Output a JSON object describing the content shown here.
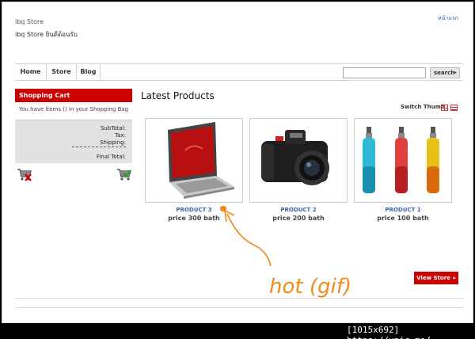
{
  "header": {
    "store_name": "ibq Store",
    "tagline": "ibq Store ยินดีต้อนรับ",
    "home_link": "หน้าแรก"
  },
  "nav": {
    "items": [
      {
        "label": "Home"
      },
      {
        "label": "Store"
      },
      {
        "label": "Blog"
      }
    ],
    "search_value": "",
    "search_button": "search",
    "search_arrow": "▸"
  },
  "cart": {
    "title": "Shopping Cart",
    "info": "You have items () in your Shopping Bag",
    "subtotal_label": "SubTotal:",
    "tax_label": "Tax:",
    "shipping_label": "Shipping:",
    "final_label": "Final Total:"
  },
  "main": {
    "title": "Latest Products",
    "switch_label": "Switch Thumb",
    "products": [
      {
        "name": "PRODUCT 3",
        "price": "price 300 bath"
      },
      {
        "name": "PRODUCT 2",
        "price": "price 200 bath"
      },
      {
        "name": "PRODUCT 1",
        "price": "price 100 bath"
      }
    ],
    "view_store": "View Store »"
  },
  "annotation": {
    "text": "hot (gif)",
    "color": "#f08a1a"
  },
  "watermark": "[1015x692] https://upic.me/",
  "colors": {
    "accent": "#cc0000",
    "link": "#3a63a8"
  }
}
